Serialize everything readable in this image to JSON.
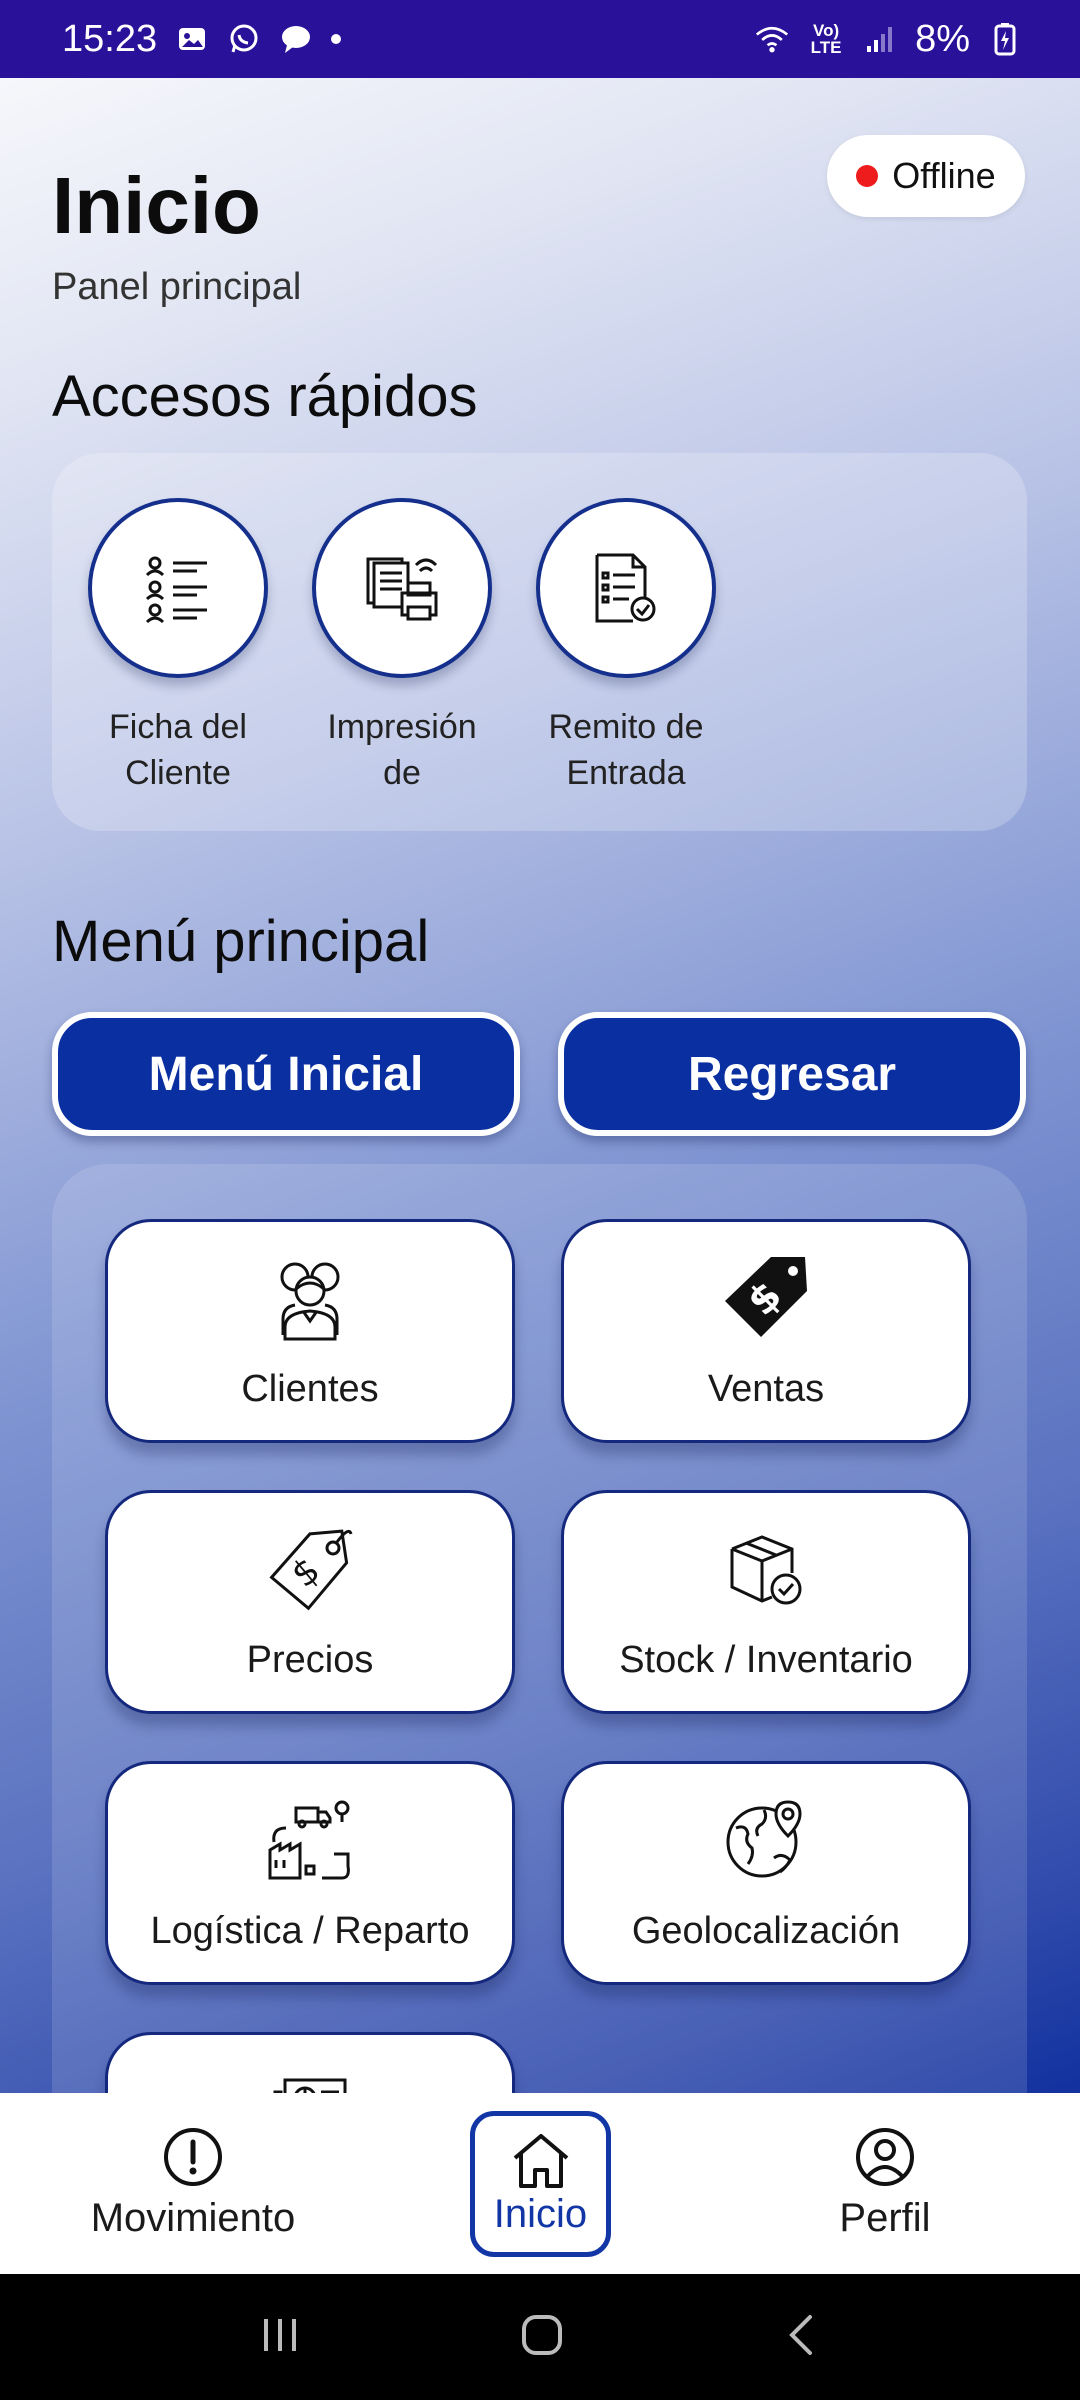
{
  "status_bar": {
    "time": "15:23",
    "battery": "8%",
    "net_label": "Vo) LTE"
  },
  "header": {
    "title": "Inicio",
    "subtitle": "Panel principal",
    "connection_status": "Offline",
    "status_color": "#ee1c1c"
  },
  "quick_access": {
    "title": "Accesos rápidos",
    "items": [
      {
        "label": "Ficha del Cliente",
        "icon": "client-list-icon"
      },
      {
        "label": "Impresión de",
        "icon": "printer-icon"
      },
      {
        "label": "Remito de Entrada",
        "icon": "receipt-check-icon"
      }
    ]
  },
  "main_menu": {
    "title": "Menú principal",
    "initial_button": "Menú Inicial",
    "back_button": "Regresar",
    "tiles": [
      {
        "label": "Clientes",
        "icon": "people-icon"
      },
      {
        "label": "Ventas",
        "icon": "price-tag-dollar-icon"
      },
      {
        "label": "Precios",
        "icon": "tag-dollar-icon"
      },
      {
        "label": "Stock / Inventario",
        "icon": "box-check-icon"
      },
      {
        "label": "Logística / Reparto",
        "icon": "delivery-truck-icon"
      },
      {
        "label": "Geolocalización",
        "icon": "globe-pin-icon"
      },
      {
        "label": "",
        "icon": "report-chart-icon"
      }
    ]
  },
  "bottom_nav": {
    "items": [
      {
        "label": "Movimiento",
        "icon": "alert-circle-icon"
      },
      {
        "label": "Inicio",
        "icon": "home-icon",
        "active": true
      },
      {
        "label": "Perfil",
        "icon": "user-circle-icon"
      }
    ]
  },
  "colors": {
    "accent": "#0a2fa1",
    "status_bar": "#2a1199"
  }
}
